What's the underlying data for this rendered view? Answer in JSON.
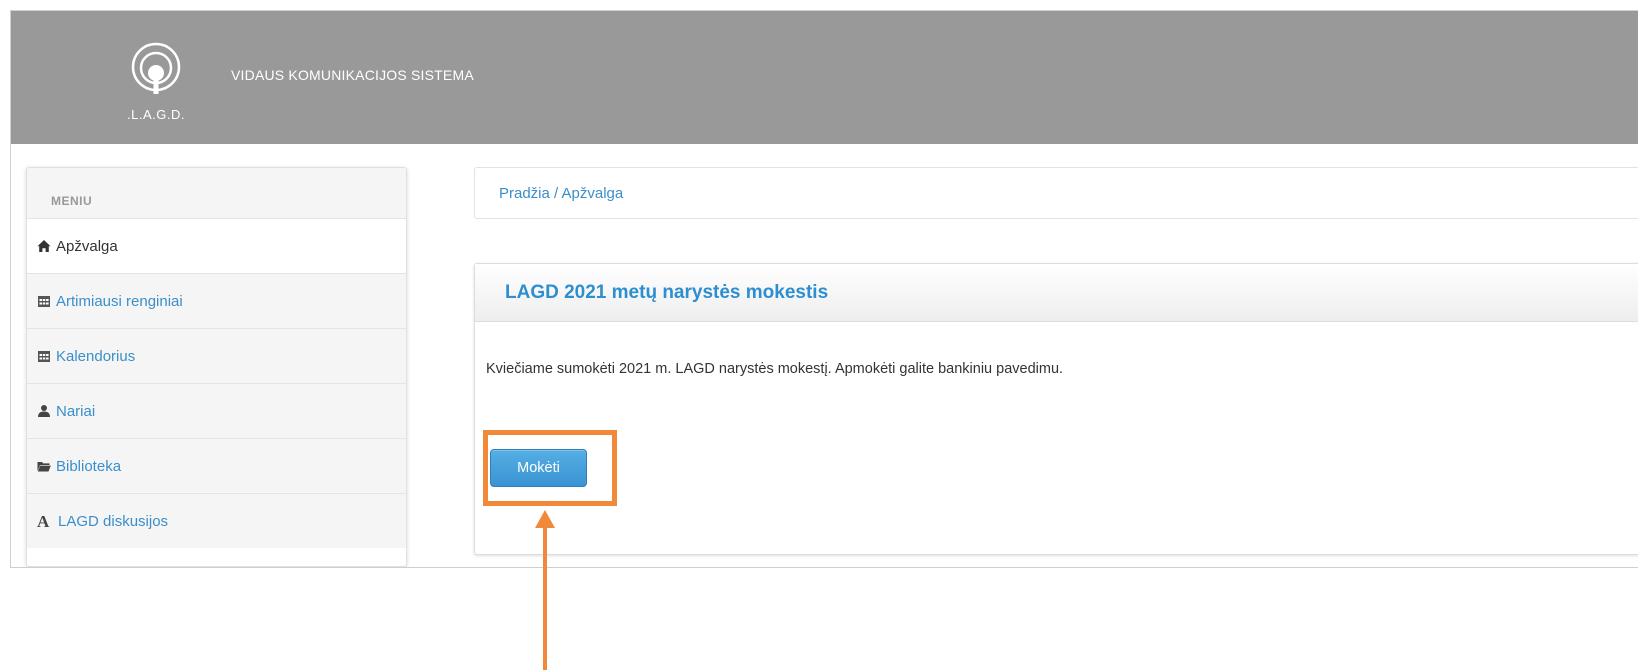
{
  "header": {
    "logo_text": ".L.A.G.D.",
    "app_title": "VIDAUS KOMUNIKACIJOS SISTEMA"
  },
  "sidebar": {
    "title": "MENIU",
    "items": [
      {
        "label": "Apžvalga",
        "icon": "home-icon",
        "active": true
      },
      {
        "label": "Artimiausi renginiai",
        "icon": "calendar-icon"
      },
      {
        "label": "Kalendorius",
        "icon": "calendar-icon"
      },
      {
        "label": "Nariai",
        "icon": "user-icon"
      },
      {
        "label": "Biblioteka",
        "icon": "folder-icon"
      },
      {
        "label": "LAGD diskusijos",
        "icon": "font-icon",
        "glyph": "A"
      }
    ]
  },
  "breadcrumb": {
    "text": "Pradžia / Apžvalga"
  },
  "panel": {
    "title": "LAGD 2021 metų narystės mokestis",
    "text": "Kviečiame sumokėti 2021 m. LAGD narystės mokestį. Apmokėti galite bankiniu pavedimu.",
    "button_label": "Mokėti"
  },
  "annotation": {
    "color": "#f08a3a"
  },
  "colors": {
    "header_bg": "#999999",
    "link": "#3a8fca",
    "button": "#3a94d2"
  }
}
